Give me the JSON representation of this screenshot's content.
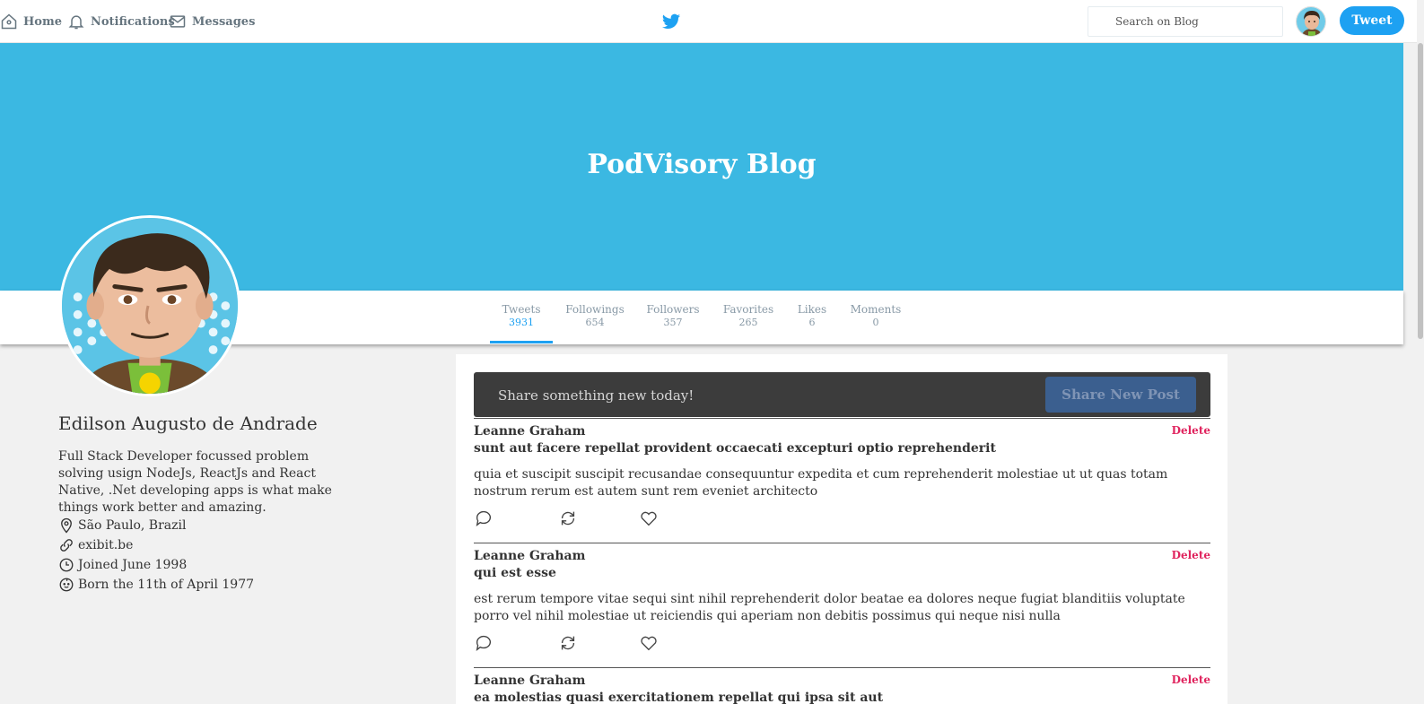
{
  "nav": {
    "home": "Home",
    "notifications": "Notifications",
    "messages": "Messages",
    "search_placeholder": "Search on Blog",
    "tweet_button": "Tweet"
  },
  "banner": {
    "title": "PodVisory Blog"
  },
  "stats": [
    {
      "label": "Tweets",
      "value": "3931"
    },
    {
      "label": "Followings",
      "value": "654"
    },
    {
      "label": "Followers",
      "value": "357"
    },
    {
      "label": "Favorites",
      "value": "265"
    },
    {
      "label": "Likes",
      "value": "6"
    },
    {
      "label": "Moments",
      "value": "0"
    }
  ],
  "profile": {
    "name": "Edilson Augusto de Andrade",
    "bio": "Full Stack Developer focussed problem solving usign NodeJs, ReactJs and React Native, .Net developing apps is what make things work better and amazing.",
    "location": "São Paulo, Brazil",
    "website": "exibit.be",
    "joined": "Joined June 1998",
    "born": "Born the 11th of April 1977"
  },
  "share": {
    "prompt": "Share something new today!",
    "button": "Share New Post"
  },
  "posts": [
    {
      "author": "Leanne Graham",
      "delete_label": "Delete",
      "title": "sunt aut facere repellat provident occaecati excepturi optio reprehenderit",
      "body": "quia et suscipit suscipit recusandae consequuntur expedita et cum reprehenderit molestiae ut ut quas totam nostrum rerum est autem sunt rem eveniet architecto"
    },
    {
      "author": "Leanne Graham",
      "delete_label": "Delete",
      "title": "qui est esse",
      "body": "est rerum tempore vitae sequi sint nihil reprehenderit dolor beatae ea dolores neque fugiat blanditiis voluptate porro vel nihil molestiae ut reiciendis qui aperiam non debitis possimus qui neque nisi nulla"
    },
    {
      "author": "Leanne Graham",
      "delete_label": "Delete",
      "title": "ea molestias quasi exercitationem repellat qui ipsa sit aut",
      "body": ""
    }
  ],
  "colors": {
    "accent": "#1da1f2",
    "banner": "#3bb8e2",
    "delete": "#e0245e"
  }
}
